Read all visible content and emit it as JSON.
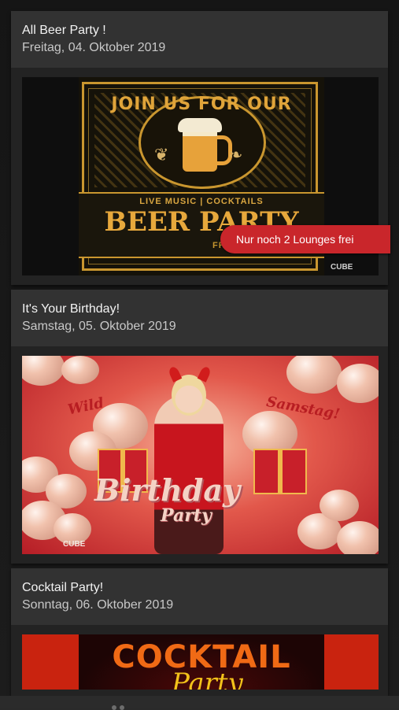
{
  "events": [
    {
      "title": "All Beer Party !",
      "date": "Freitag, 04. Oktober 2019",
      "poster": {
        "headline": "JOIN US FOR OUR",
        "sub": "LIVE MUSIC | COCKTAILS",
        "main": "BEER PARTY",
        "day": "FREITAG",
        "logo": "CUBE"
      },
      "badge": "Nur noch 2 Lounges frei"
    },
    {
      "title": "It's Your Birthday!",
      "date": "Samstag, 05. Oktober 2019",
      "poster": {
        "wild": "Wild",
        "saturday": "Samstag!",
        "main": "Birthday",
        "party": "Party",
        "logo": "CUBE"
      }
    },
    {
      "title": "Cocktail Party!",
      "date": "Sonntag, 06. Oktober 2019",
      "poster": {
        "main": "COCKTAIL",
        "script": "Party"
      }
    }
  ],
  "colors": {
    "badge": "#c9262b",
    "card": "#2c2c2c",
    "background": "#151515"
  }
}
